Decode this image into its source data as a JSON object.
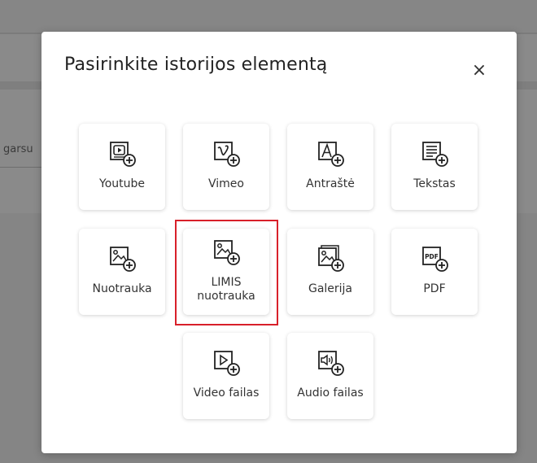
{
  "background": {
    "partial_input_text": "garsu"
  },
  "modal": {
    "title": "Pasirinkite istorijos elementą",
    "close_symbol": "×",
    "tiles": [
      {
        "label": "Youtube",
        "icon": "youtube-icon"
      },
      {
        "label": "Vimeo",
        "icon": "vimeo-icon"
      },
      {
        "label": "Antraštė",
        "icon": "heading-icon"
      },
      {
        "label": "Tekstas",
        "icon": "text-icon"
      },
      {
        "label": "Nuotrauka",
        "icon": "image-icon"
      },
      {
        "label_line1": "LIMIS",
        "label_line2": "nuotrauka",
        "icon": "limis-image-icon",
        "highlighted": true
      },
      {
        "label": "Galerija",
        "icon": "gallery-icon"
      },
      {
        "label": "PDF",
        "icon": "pdf-icon",
        "icon_text": "PDF"
      },
      {
        "label": "Video failas",
        "icon": "video-file-icon"
      },
      {
        "label": "Audio failas",
        "icon": "audio-file-icon"
      }
    ]
  },
  "colors": {
    "highlight": "#d8202a",
    "overlay": "#8a8a8a"
  }
}
